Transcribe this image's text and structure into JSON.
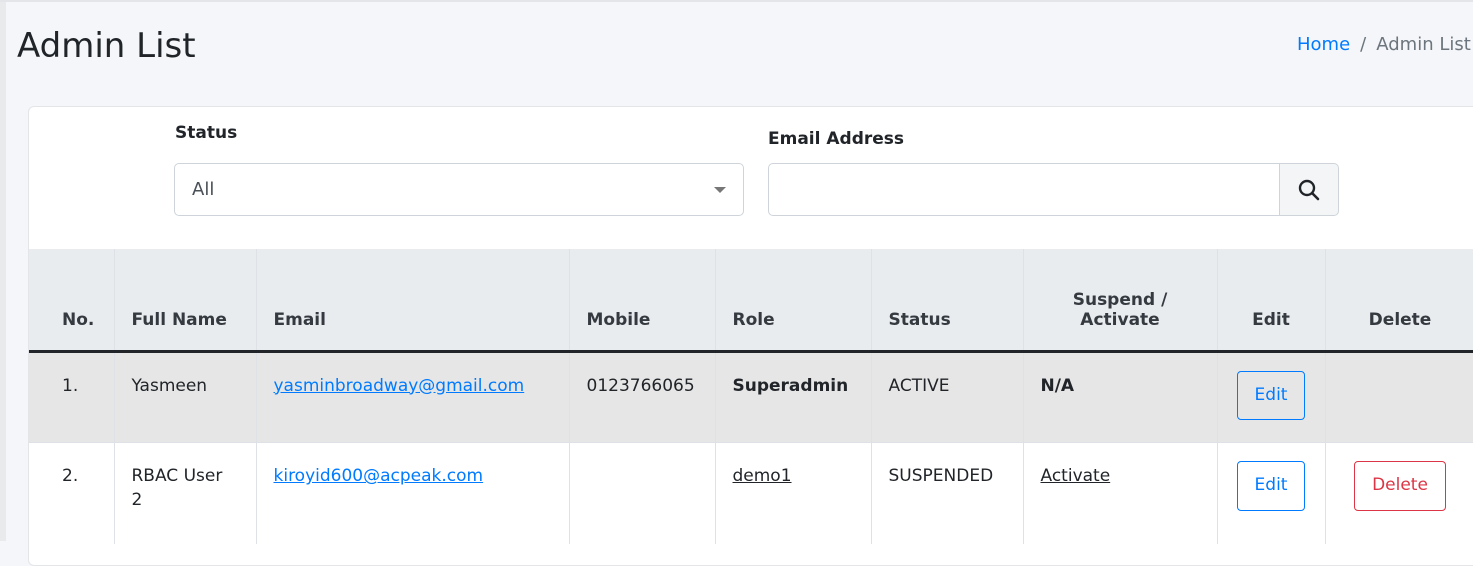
{
  "page": {
    "title": "Admin List"
  },
  "breadcrumb": {
    "home": "Home",
    "separator": "/",
    "current": "Admin List"
  },
  "filters": {
    "status_label": "Status",
    "status_value": "All",
    "email_label": "Email Address",
    "email_value": "",
    "email_placeholder": ""
  },
  "table": {
    "headers": [
      "No.",
      "Full Name",
      "Email",
      "Mobile",
      "Role",
      "Status",
      "Suspend / Activate",
      "Edit",
      "Delete"
    ],
    "rows": [
      {
        "no": "1.",
        "name": "Yasmeen",
        "email": "yasminbroadway@gmail.com",
        "mobile": "0123766065",
        "role": "Superadmin",
        "status": "ACTIVE",
        "action": "N/A",
        "edit": "Edit",
        "delete": ""
      },
      {
        "no": "2.",
        "name": "RBAC User 2",
        "email": "kiroyid600@acpeak.com",
        "mobile": "",
        "role": "demo1",
        "status": "SUSPENDED",
        "action": "Activate",
        "edit": "Edit",
        "delete": "Delete"
      }
    ]
  },
  "colors": {
    "primary": "#007bff",
    "danger": "#dc3545"
  }
}
